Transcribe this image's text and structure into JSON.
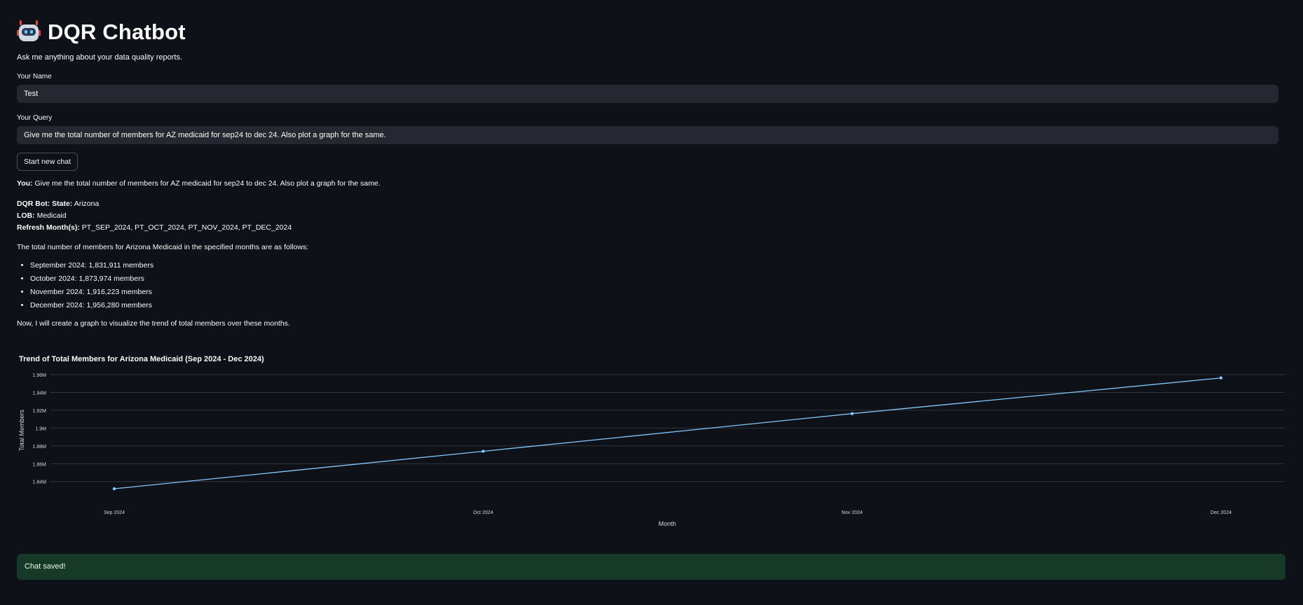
{
  "header": {
    "title": "DQR Chatbot",
    "icon": "robot-icon"
  },
  "subtitle": "Ask me anything about your data quality reports.",
  "name_field": {
    "label": "Your Name",
    "value": "Test"
  },
  "query_field": {
    "label": "Your Query",
    "value": "Give me the total number of members for AZ medicaid for sep24 to dec 24. Also plot a graph for the same."
  },
  "new_chat_button": "Start new chat",
  "user_message": {
    "speaker": "You:",
    "text": " Give me the total number of members for AZ medicaid for sep24 to dec 24. Also plot a graph for the same."
  },
  "bot_message": {
    "speaker": "DQR Bot:",
    "state_label": "State:",
    "state_value": " Arizona",
    "lob_label": "LOB:",
    "lob_value": " Medicaid",
    "refresh_label": "Refresh Month(s):",
    "refresh_value": " PT_SEP_2024, PT_OCT_2024, PT_NOV_2024, PT_DEC_2024",
    "intro": "The total number of members for Arizona Medicaid in the specified months are as follows:",
    "items": [
      "September 2024: 1,831,911 members",
      "October 2024: 1,873,974 members",
      "November 2024: 1,916,223 members",
      "December 2024: 1,956,280 members"
    ],
    "outro": "Now, I will create a graph to visualize the trend of total members over these months."
  },
  "chart_data": {
    "type": "line",
    "title": "Trend of Total Members for Arizona Medicaid (Sep 2024 - Dec 2024)",
    "xlabel": "Month",
    "ylabel": "Total Members",
    "categories": [
      "Sep 2024",
      "Oct 2024",
      "Nov 2024",
      "Dec 2024"
    ],
    "series": [
      {
        "values": [
          1831911,
          1873974,
          1916223,
          1956280
        ]
      }
    ],
    "yticks": [
      1840000,
      1860000,
      1880000,
      1900000,
      1920000,
      1940000,
      1960000
    ],
    "ytick_labels": [
      "1.84M",
      "1.86M",
      "1.88M",
      "1.9M",
      "1.92M",
      "1.94M",
      "1.96M"
    ],
    "ylim": [
      1831911,
      1960000
    ],
    "grid": true,
    "line_color": "#83c9ff"
  },
  "status_message": "Chat saved!"
}
